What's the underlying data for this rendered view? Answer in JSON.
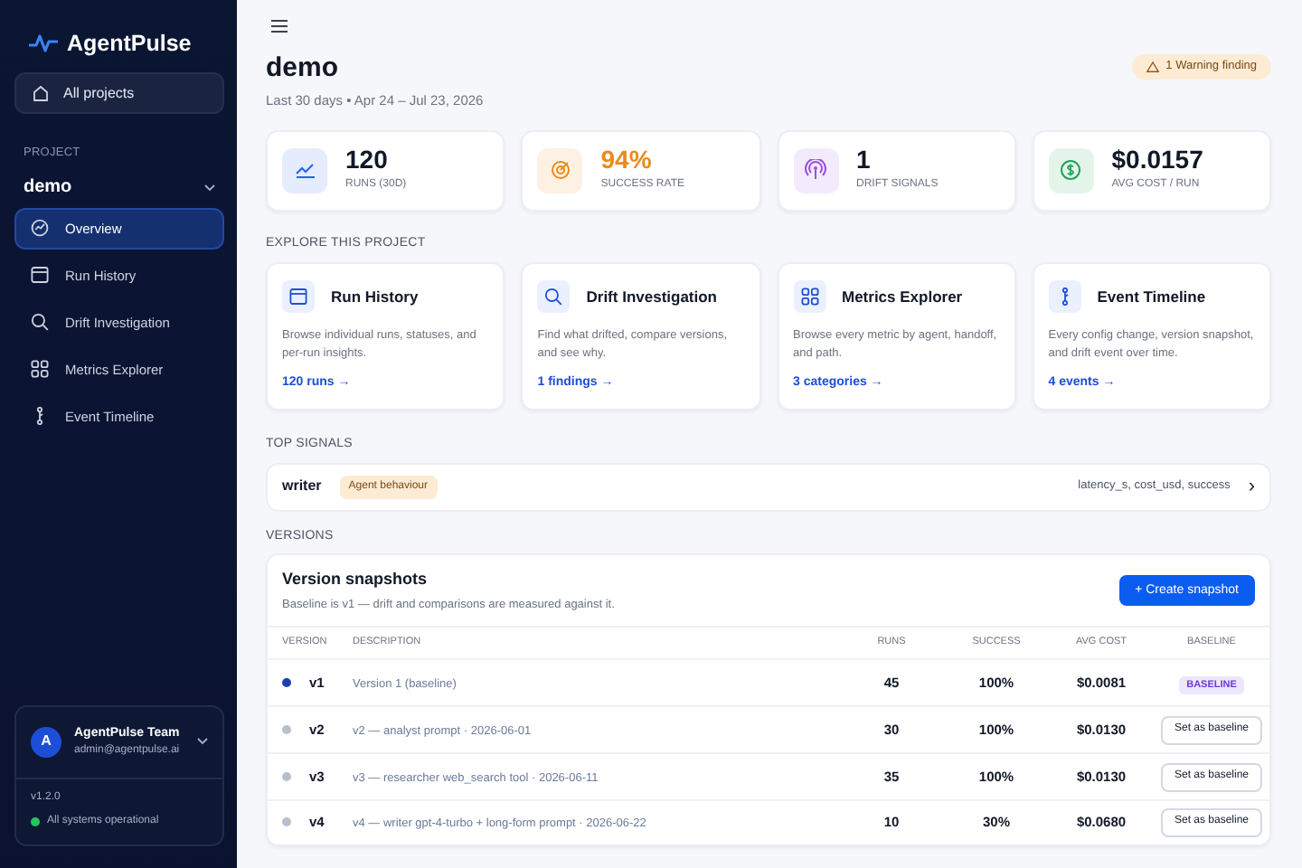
{
  "brand": {
    "name": "AgentPulse"
  },
  "sidebar": {
    "all_projects": "All projects",
    "project_label": "PROJECT",
    "project": "demo",
    "items": [
      {
        "label": "Overview",
        "selected": true
      },
      {
        "label": "Run History",
        "selected": false
      },
      {
        "label": "Drift Investigation",
        "selected": false
      },
      {
        "label": "Metrics Explorer",
        "selected": false
      },
      {
        "label": "Event Timeline",
        "selected": false
      }
    ],
    "account": {
      "avatar": "A",
      "name": "AgentPulse Team",
      "email": "admin@agentpulse.ai",
      "version": "v1.2.0",
      "status": {
        "text": "All systems operational",
        "color": "#22c55e"
      }
    }
  },
  "header": {
    "title": "demo",
    "subtitle": "Last 30 days • Apr 24 – Jul 23, 2026",
    "warning": "1 Warning finding"
  },
  "stats": [
    {
      "value": "120",
      "label": "RUNS (30D)",
      "color": "#2563eb",
      "accent": false
    },
    {
      "value": "94%",
      "label": "SUCCESS RATE",
      "color": "#ea8a1a",
      "accent": true
    },
    {
      "value": "1",
      "label": "DRIFT SIGNALS",
      "color": "#9b4fe0",
      "accent": false
    },
    {
      "value": "$0.0157",
      "label": "AVG COST / RUN",
      "color": "#22a35a",
      "accent": false
    }
  ],
  "explore": {
    "heading": "EXPLORE THIS PROJECT",
    "cards": [
      {
        "title": "Run History",
        "text": "Browse individual runs, statuses, and per-run insights.",
        "link": "120 runs →"
      },
      {
        "title": "Drift Investigation",
        "text": "Find what drifted, compare versions, and see why.",
        "link": "1 findings →"
      },
      {
        "title": "Metrics Explorer",
        "text": "Browse every metric by agent, handoff, and path.",
        "link": "3 categories →"
      },
      {
        "title": "Event Timeline",
        "text": "Every config change, version snapshot, and drift event over time.",
        "link": "4 events →"
      }
    ]
  },
  "top_signals": {
    "heading": "TOP SIGNALS",
    "rows": [
      {
        "agent": "writer",
        "tag": "Agent behaviour",
        "metrics": "latency_s, cost_usd, success",
        "chevron": "›"
      }
    ]
  },
  "versions": {
    "heading": "VERSIONS",
    "title": "Version snapshots",
    "subtitle": "Baseline is v1 — drift and comparisons are measured against it.",
    "create_button": "+ Create snapshot",
    "columns": [
      "VERSION",
      "DESCRIPTION",
      "RUNS",
      "SUCCESS",
      "AVG COST",
      "BASELINE"
    ],
    "rows": [
      {
        "version": "v1",
        "description": "Version 1 (baseline)",
        "runs": "45",
        "success": "100%",
        "avg_cost": "$0.0081",
        "baseline": true,
        "baseline_text": "BASELINE"
      },
      {
        "version": "v2",
        "description": "v2 — analyst prompt · 2026-06-01",
        "runs": "30",
        "success": "100%",
        "avg_cost": "$0.0130",
        "baseline": false,
        "baseline_text": "Set as baseline"
      },
      {
        "version": "v3",
        "description": "v3 — researcher web_search tool · 2026-06-11",
        "runs": "35",
        "success": "100%",
        "avg_cost": "$0.0130",
        "baseline": false,
        "baseline_text": "Set as baseline"
      },
      {
        "version": "v4",
        "description": "v4 — writer gpt-4-turbo + long-form prompt · 2026-06-22",
        "runs": "10",
        "success": "30%",
        "avg_cost": "$0.0680",
        "baseline": false,
        "baseline_text": "Set as baseline"
      }
    ]
  }
}
